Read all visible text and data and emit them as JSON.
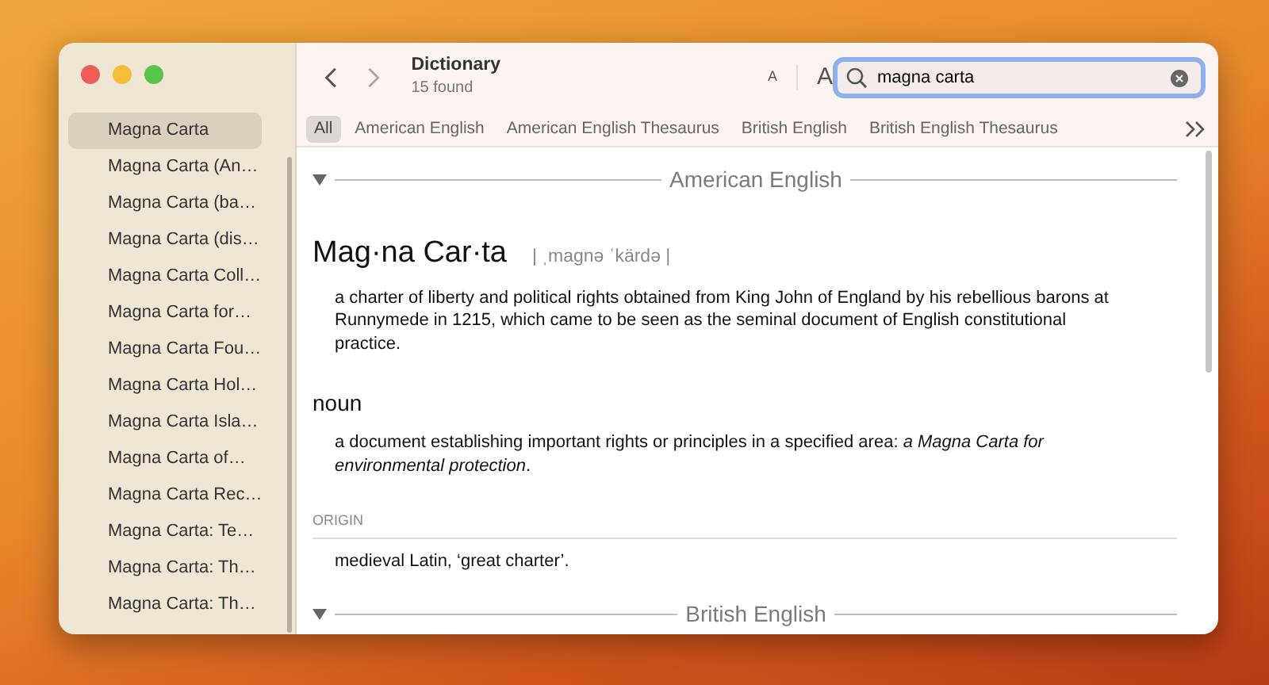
{
  "sidebar": {
    "items": [
      {
        "label": "Magna Carta",
        "selected": true
      },
      {
        "label": "Magna Carta (An…",
        "selected": false
      },
      {
        "label": "Magna Carta (ba…",
        "selected": false
      },
      {
        "label": "Magna Carta (dis…",
        "selected": false
      },
      {
        "label": "Magna Carta Coll…",
        "selected": false
      },
      {
        "label": "Magna Carta for…",
        "selected": false
      },
      {
        "label": "Magna Carta Fou…",
        "selected": false
      },
      {
        "label": "Magna Carta Hol…",
        "selected": false
      },
      {
        "label": "Magna Carta Isla…",
        "selected": false
      },
      {
        "label": "Magna Carta of…",
        "selected": false
      },
      {
        "label": "Magna Carta Rec…",
        "selected": false
      },
      {
        "label": "Magna Carta: Te…",
        "selected": false
      },
      {
        "label": "Magna Carta: Th…",
        "selected": false
      },
      {
        "label": "Magna Carta: Th…",
        "selected": false
      }
    ]
  },
  "toolbar": {
    "title": "Dictionary",
    "subtitle": "15 found",
    "font_buttons": [
      "A",
      "A"
    ],
    "search": {
      "value": "magna carta"
    }
  },
  "sources": [
    {
      "label": "All",
      "selected": true
    },
    {
      "label": "American English",
      "selected": false
    },
    {
      "label": "American English Thesaurus",
      "selected": false
    },
    {
      "label": "British English",
      "selected": false
    },
    {
      "label": "British English Thesaurus",
      "selected": false
    }
  ],
  "sections": [
    {
      "title": "American English",
      "expanded": true,
      "blocks": [
        {
          "kind": "headword",
          "text": "Mag·na Car·ta",
          "pronunciation": "| ˌmagnə ˈkärdə |"
        },
        {
          "kind": "definition",
          "text": "a charter of liberty and political rights obtained from King John of England by his rebellious barons at Runnymede in 1215, which came to be seen as the seminal document of English constitutional practice."
        },
        {
          "kind": "pos",
          "text": "noun"
        },
        {
          "kind": "definition",
          "text": "a document establishing important rights or principles in a specified area: *a Magna Carta for environmental protection*."
        },
        {
          "kind": "label",
          "text": "ORIGIN"
        },
        {
          "kind": "definition",
          "text": "medieval Latin, ‘great charter’."
        }
      ]
    },
    {
      "title": "British English",
      "expanded": true
    }
  ]
}
